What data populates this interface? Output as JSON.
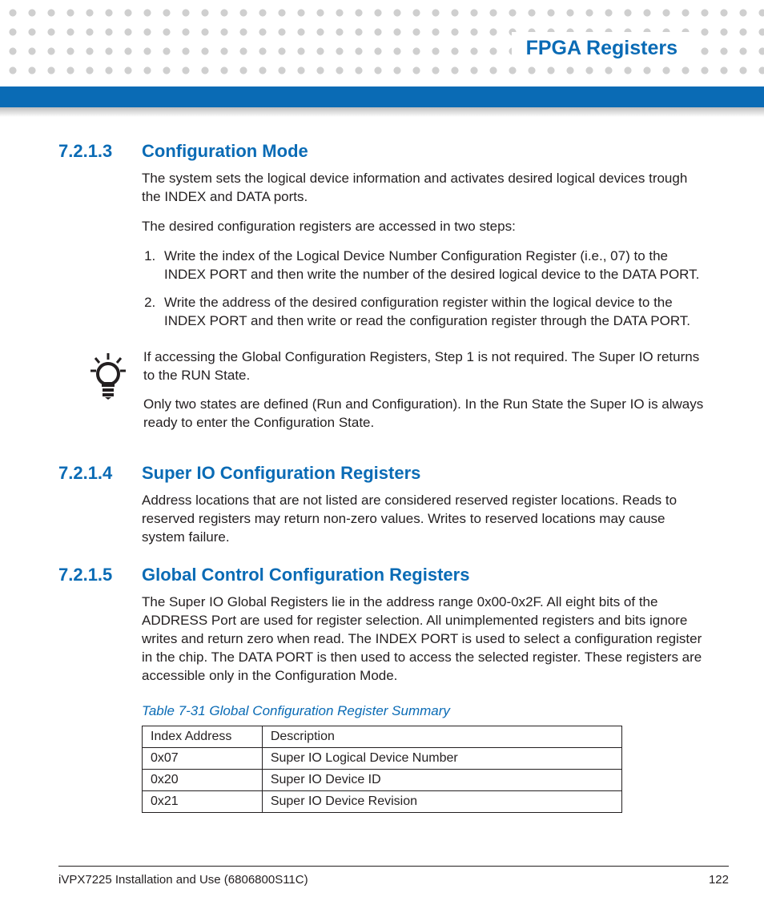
{
  "header": {
    "title": "FPGA Registers"
  },
  "sections": [
    {
      "num": "7.2.1.3",
      "title": "Configuration Mode",
      "p1": "The system sets the logical device information and activates desired logical devices trough the INDEX and DATA ports.",
      "p2": "The desired configuration registers are accessed in two steps:",
      "li1": "Write the index of the Logical Device Number Configuration Register (i.e., 07) to the INDEX PORT and then write the number of the desired logical device to the DATA PORT.",
      "li2": "Write the address of the desired configuration register within the logical device to the INDEX PORT and then write or read the configuration register through the DATA PORT."
    },
    {
      "note_p1": "If accessing the Global Configuration Registers, Step 1 is not required. The Super IO returns to the RUN State.",
      "note_p2": "Only two states are defined (Run and Configuration). In the Run State the Super IO is always ready to enter the Configuration State."
    },
    {
      "num": "7.2.1.4",
      "title": "Super IO Configuration Registers",
      "p1": "Address locations that are not listed are considered reserved register locations. Reads to reserved registers may return non-zero values. Writes to reserved locations may cause system failure."
    },
    {
      "num": "7.2.1.5",
      "title": "Global Control Configuration Registers",
      "p1": "The Super IO Global Registers lie in the address range 0x00-0x2F. All eight bits of the ADDRESS Port are used for register selection. All unimplemented registers and bits ignore writes and return zero when read. The INDEX PORT is used to select a configuration register in the chip. The DATA PORT is then used to access the selected register. These registers are accessible only in the Configuration Mode."
    }
  ],
  "table": {
    "caption": "Table 7-31 Global Configuration Register Summary",
    "h1": "Index Address",
    "h2": "Description",
    "rows": [
      {
        "a": "0x07",
        "b": "Super IO Logical Device Number"
      },
      {
        "a": "0x20",
        "b": "Super IO Device ID"
      },
      {
        "a": "0x21",
        "b": "Super IO Device Revision"
      }
    ]
  },
  "footer": {
    "left": "iVPX7225 Installation and Use (6806800S11C)",
    "right": "122"
  }
}
